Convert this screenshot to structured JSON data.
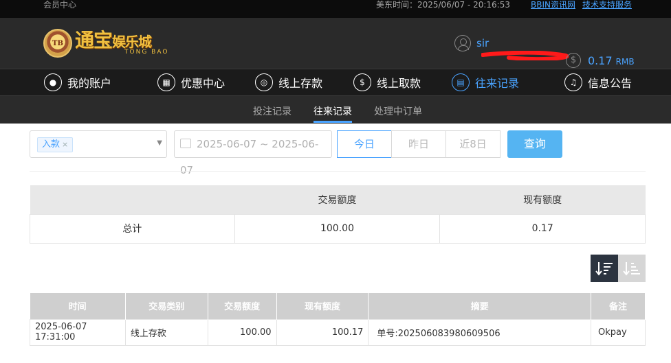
{
  "topbar": {
    "member_center": "会员中心",
    "clock": "美东时间：2025/06/07 - 20:16:53",
    "link_bbin": "BBIN资讯网",
    "link_support": "技术支持服务"
  },
  "logo": {
    "badge": "TB",
    "cn_name": "通宝",
    "cn_sub": "娱乐城",
    "en_name": "TONG BAO"
  },
  "user": {
    "username": "sir",
    "balance": "0.17",
    "currency": "RMB"
  },
  "nav": {
    "items": [
      {
        "label": "我的账户",
        "icon": "user-icon"
      },
      {
        "label": "优惠中心",
        "icon": "gift-icon"
      },
      {
        "label": "线上存款",
        "icon": "deposit-icon"
      },
      {
        "label": "线上取款",
        "icon": "withdraw-icon"
      },
      {
        "label": "往来记录",
        "icon": "records-icon"
      },
      {
        "label": "信息公告",
        "icon": "bell-icon"
      }
    ],
    "active": "往来记录"
  },
  "subnav": {
    "items": [
      "投注记录",
      "往来记录",
      "处理中订单"
    ],
    "active": "往来记录"
  },
  "filters": {
    "type_tag": "入款",
    "date_range": "2025-06-07 ~ 2025-06-07",
    "quick": [
      "今日",
      "昨日",
      "近8日"
    ],
    "quick_active": "今日",
    "search_label": "查询"
  },
  "summary": {
    "headers": [
      "",
      "交易额度",
      "现有额度"
    ],
    "row": [
      "总计",
      "100.00",
      "0.17"
    ]
  },
  "detail": {
    "headers": [
      "时间",
      "交易类别",
      "交易额度",
      "现有额度",
      "摘要",
      "备注"
    ],
    "rows": [
      [
        "2025-06-07 17:31:00",
        "线上存款",
        "100.00",
        "100.17",
        "单号:202506083980609506",
        "Okpay"
      ]
    ]
  },
  "colors": {
    "accent": "#4aa3ff",
    "header_bg": "#2a2a2a",
    "nav_bg": "#1b1b1b",
    "search_btn": "#55b4f2"
  }
}
